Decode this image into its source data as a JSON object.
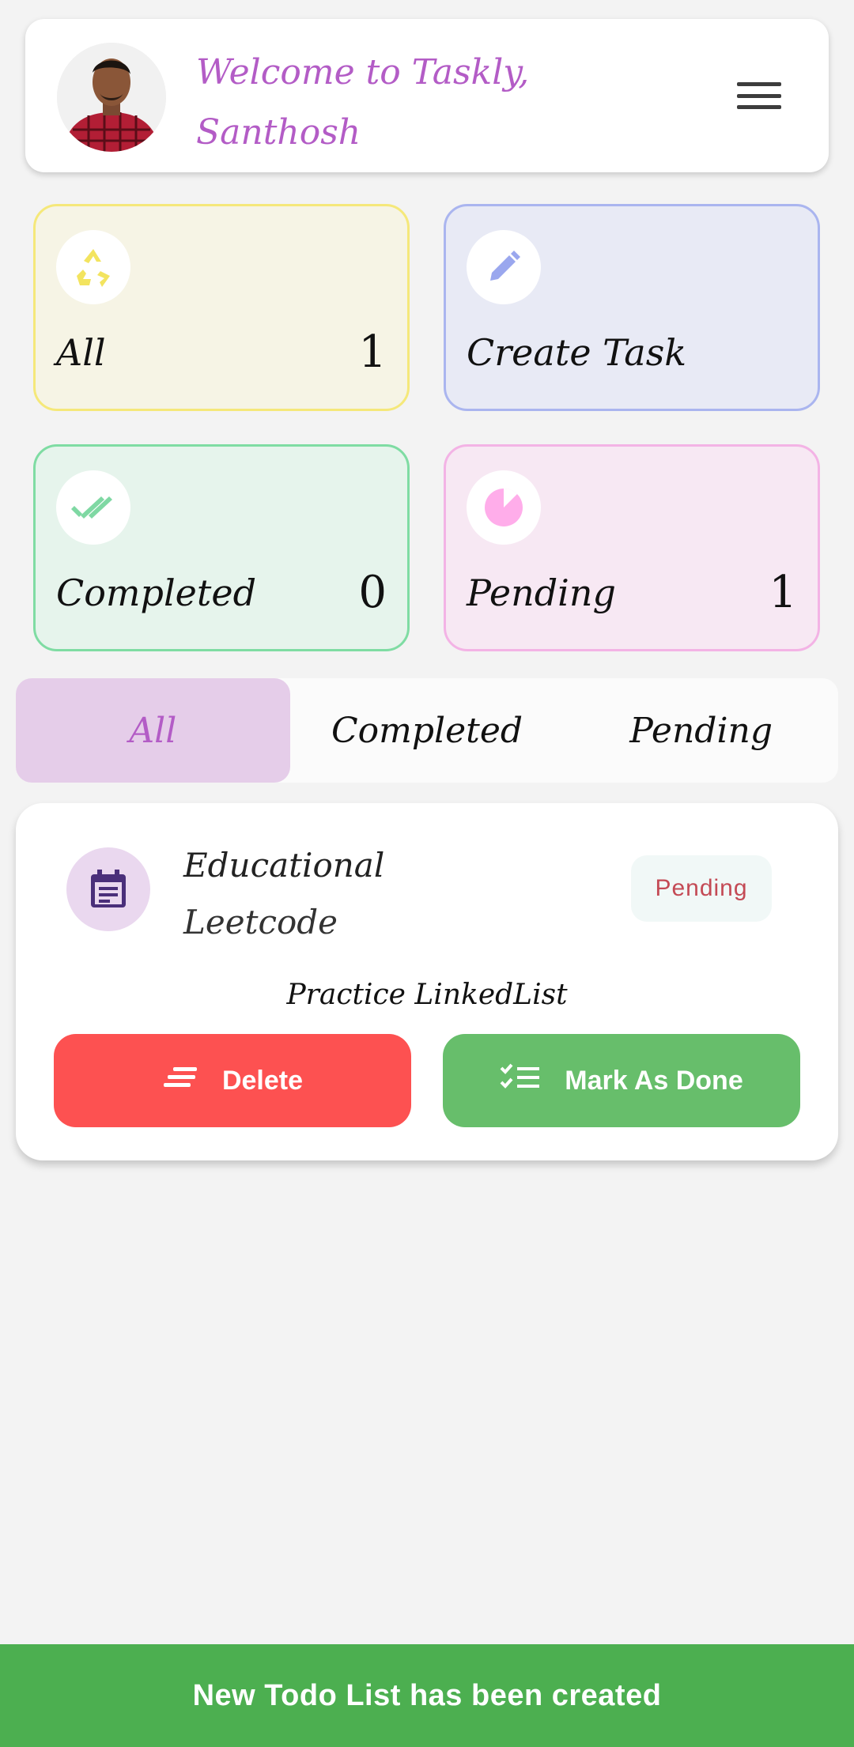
{
  "header": {
    "welcome_line1": "Welcome to Taskly,",
    "welcome_line2": "Santhosh",
    "menu_icon": "hamburger-menu-icon",
    "accent_color": "#b35cc6"
  },
  "stats": {
    "all": {
      "label": "All",
      "count": "1",
      "icon": "recycle-icon",
      "color": "#f5e87a"
    },
    "create": {
      "label": "Create Task",
      "icon": "pencil-icon",
      "color": "#aab5ef"
    },
    "completed": {
      "label": "Completed",
      "count": "0",
      "icon": "double-check-icon",
      "color": "#7fdca3"
    },
    "pending": {
      "label": "Pending",
      "count": "1",
      "icon": "pie-chart-icon",
      "color": "#f3b3e5"
    }
  },
  "tabs": [
    {
      "label": "All",
      "active": true
    },
    {
      "label": "Completed",
      "active": false
    },
    {
      "label": "Pending",
      "active": false
    }
  ],
  "task": {
    "category": "Educational",
    "name": "Leetcode",
    "status": "Pending",
    "description": "Practice LinkedList",
    "icon": "calendar-note-icon",
    "delete_label": "Delete",
    "done_label": "Mark As Done"
  },
  "snackbar": {
    "message": "New Todo List has been created",
    "color": "#4caf50"
  }
}
